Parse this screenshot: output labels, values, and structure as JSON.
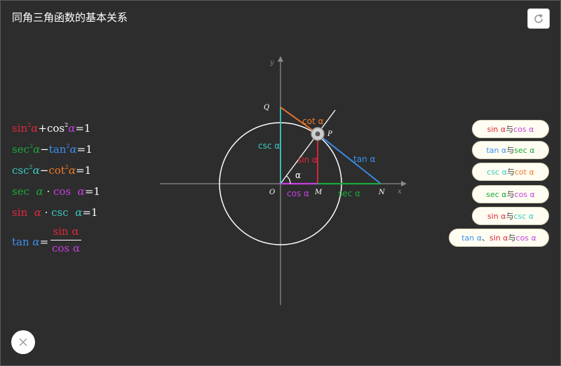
{
  "title": "同角三角函数的基本关系",
  "colors": {
    "sin": "#e0283c",
    "cos": "#c440e0",
    "tan": "#3b8ff0",
    "sec": "#1aa83a",
    "csc": "#3cc8c0",
    "cot": "#f07a2a",
    "text": "#ffffff"
  },
  "formulas": {
    "f1": {
      "a": "sin",
      "b": "α",
      "op": "+",
      "c": "cos",
      "d": "α",
      "eq": "=1",
      "sup": "2"
    },
    "f2": {
      "a": "sec",
      "b": "α",
      "op": "−",
      "c": "tan",
      "d": "α",
      "eq": "=1",
      "sup": "2"
    },
    "f3": {
      "a": "csc",
      "b": "α",
      "op": "−",
      "c": "cot",
      "d": "α",
      "eq": "=1",
      "sup": "2"
    },
    "f4": {
      "a": "sec",
      "b": "α",
      "op": " · ",
      "c": "cos",
      "d": "α",
      "eq": "=1"
    },
    "f5": {
      "a": "sin",
      "b": "α",
      "op": " · ",
      "c": "csc",
      "d": "α",
      "eq": "=1"
    },
    "f6": {
      "lhs": "tan",
      "alpha": "α",
      "eq": "=",
      "num": "sin α",
      "den": "cos α"
    }
  },
  "buttons": [
    {
      "a": "sin α",
      "sep": " 与 ",
      "b": "cos α"
    },
    {
      "a": "tan α",
      "sep": " 与 ",
      "b": "sec α"
    },
    {
      "a": "csc α",
      "sep": " 与 ",
      "b": "cot α"
    },
    {
      "a": "sec α",
      "sep": " 与 ",
      "b": "cos α"
    },
    {
      "a": "sin α",
      "sep": " 与 ",
      "b": "csc α"
    },
    {
      "a": "tan α",
      "sep": " 、",
      "b": "sin α",
      "sep2": " 与 ",
      "c": "cos α"
    }
  ],
  "diagram": {
    "axis_x": "x",
    "axis_y": "y",
    "point_O": "O",
    "point_P": "P",
    "point_Q": "Q",
    "point_M": "M",
    "point_N": "N",
    "label_sin": "sin α",
    "label_cos": "cos α",
    "label_tan": "tan α",
    "label_sec": "sec α",
    "label_csc": "csc α",
    "label_cot": "cot α",
    "label_alpha": "α"
  },
  "icons": {
    "refresh": "refresh-icon",
    "close": "close-icon"
  }
}
